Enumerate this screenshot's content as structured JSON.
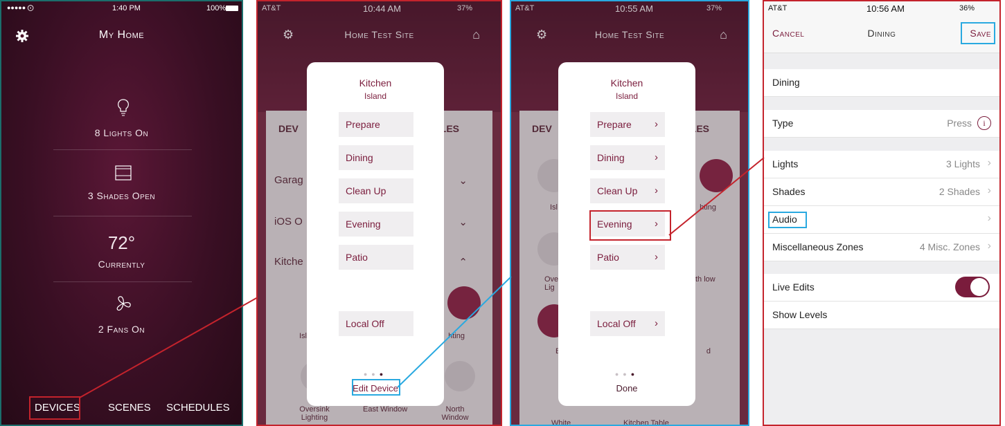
{
  "panel1": {
    "status": {
      "carrier": "●●●●● ⨀",
      "time": "1:40 PM",
      "battery": "100%"
    },
    "title": "My Home",
    "stats": {
      "lights": "8 Lights On",
      "shades": "3 Shades Open",
      "temp": "72°",
      "temp_label": "Currently",
      "fans": "2 Fans On"
    },
    "nav": {
      "devices": "DEVICES",
      "scenes": "SCENES",
      "schedules": "SCHEDULES"
    }
  },
  "panel2": {
    "status": {
      "carrier": "AT&T",
      "time": "10:44 AM",
      "battery": "37%"
    },
    "title": "Home Test Site",
    "background": {
      "tab_devices": "DEV",
      "tab_schedules": "ULES",
      "row1": "Garag",
      "row2": "iOS O",
      "row3": "Kitche",
      "label_isl": "Isl",
      "label_lighting": "hting",
      "label_oversink": "Oversink Lighting",
      "label_east": "East Window",
      "label_north": "North Window"
    },
    "modal": {
      "room": "Kitchen",
      "device": "Island",
      "buttons": [
        "Prepare",
        "Dining",
        "Clean Up",
        "Evening",
        "Patio"
      ],
      "local_off": "Local Off",
      "action": "Edit Device"
    }
  },
  "panel3": {
    "status": {
      "carrier": "AT&T",
      "time": "10:55 AM",
      "battery": "37%"
    },
    "title": "Home Test Site",
    "background": {
      "tab_devices": "DEV",
      "tab_schedules": "ULES",
      "label_isl": "Isl",
      "label_lighting": "hting",
      "label_over": "Ove Lig",
      "label_north": "th low",
      "label_b": "B",
      "label_d": "d",
      "label_white": "White",
      "label_kitchen_table": "Kitchen Table"
    },
    "modal": {
      "room": "Kitchen",
      "device": "Island",
      "buttons": [
        "Prepare",
        "Dining",
        "Clean Up",
        "Evening",
        "Patio"
      ],
      "local_off": "Local Off",
      "action": "Done"
    }
  },
  "panel4": {
    "status": {
      "carrier": "AT&T",
      "time": "10:56 AM",
      "battery": "36%"
    },
    "nav": {
      "cancel": "Cancel",
      "title": "Dining",
      "save": "Save"
    },
    "name_value": "Dining",
    "type": {
      "label": "Type",
      "value": "Press"
    },
    "rows": [
      {
        "label": "Lights",
        "value": "3 Lights"
      },
      {
        "label": "Shades",
        "value": "2 Shades"
      },
      {
        "label": "Audio",
        "value": ""
      },
      {
        "label": "Miscellaneous Zones",
        "value": "4 Misc. Zones"
      }
    ],
    "live_edits": "Live Edits",
    "live_edits_on": true,
    "show_levels": "Show Levels"
  },
  "colors": {
    "brand": "#7a1c3c",
    "highlight_red": "#c4232c",
    "highlight_blue": "#29a9e0"
  }
}
